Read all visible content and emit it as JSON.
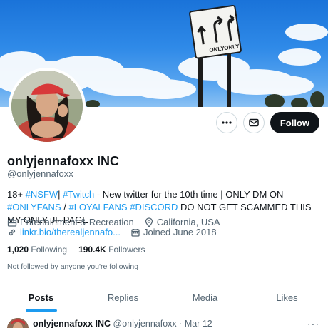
{
  "profile": {
    "name": "onlyjennafoxx INC",
    "handle": "@onlyjennafoxx",
    "bio": [
      {
        "text": "18+ ",
        "hl": false
      },
      {
        "text": "#NSFW",
        "hl": true
      },
      {
        "text": "| ",
        "hl": false
      },
      {
        "text": "#Twitch",
        "hl": true
      },
      {
        "text": " - New twitter for the 10th time  | ONLY DM ON ",
        "hl": false
      },
      {
        "text": "#ONLYFANS",
        "hl": true
      },
      {
        "text": " / ",
        "hl": false
      },
      {
        "text": "#LOYALFANS",
        "hl": true
      },
      {
        "text": " ",
        "hl": false
      },
      {
        "text": "#DISCORD",
        "hl": true
      },
      {
        "text": " DO NOT GET SCAMMED THIS MY ONLY JF PAGE",
        "hl": false
      }
    ],
    "category": "Entertainment & Recreation",
    "location": "California, USA",
    "link": "linkr.bio/therealjennafo...",
    "joined": "Joined June 2018",
    "following_count": "1,020",
    "following_label": "Following",
    "followers_count": "190.4K",
    "followers_label": "Followers",
    "not_followed": "Not followed by anyone you're following"
  },
  "banner": {
    "sign_words": [
      "ONLY",
      "ONLY"
    ]
  },
  "actions": {
    "more_icon": "more-horizontal-icon",
    "message_icon": "envelope-icon",
    "follow_label": "Follow"
  },
  "tabs": [
    {
      "label": "Posts",
      "active": true
    },
    {
      "label": "Replies",
      "active": false
    },
    {
      "label": "Media",
      "active": false
    },
    {
      "label": "Likes",
      "active": false
    }
  ],
  "tweet": {
    "author": "onlyjennafoxx INC",
    "handle": "@onlyjennafoxx",
    "sep": "·",
    "date": "Mar 12",
    "more": "···"
  },
  "colors": {
    "accent": "#1d9bf0",
    "text": "#0f1419",
    "muted": "#536471",
    "follow_bg": "#0f1419"
  }
}
